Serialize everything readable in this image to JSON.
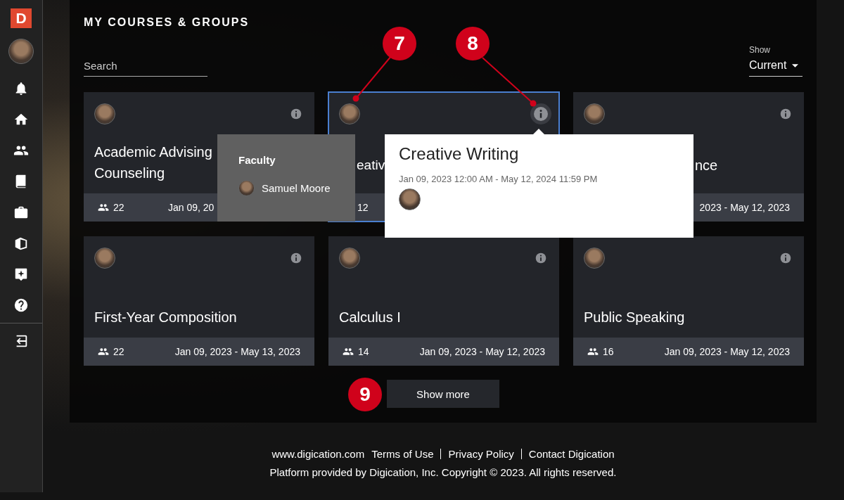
{
  "sidebar": {
    "logo": "D",
    "items": [
      {
        "kind": "bell"
      },
      {
        "kind": "home"
      },
      {
        "kind": "people"
      },
      {
        "kind": "book"
      },
      {
        "kind": "briefcase"
      },
      {
        "kind": "books"
      },
      {
        "kind": "sparkle"
      },
      {
        "kind": "help"
      },
      {
        "kind": "logout"
      }
    ]
  },
  "page": {
    "title": "MY COURSES & GROUPS",
    "search": {
      "placeholder": "Search"
    },
    "show": {
      "label": "Show",
      "value": "Current"
    }
  },
  "cards": [
    {
      "kind": "under-right",
      "title_lines": [
        "Academic Advising",
        "Counseling"
      ],
      "members": "22",
      "dates": "Jan 09, 20",
      "selected": false
    },
    {
      "kind": "under-both",
      "title_lines": [
        "eativ"
      ],
      "members": "12",
      "selected": true
    },
    {
      "kind": "under-left",
      "title_lines": [
        "nce"
      ],
      "dates": "2023 - May 12, 2023",
      "selected": false
    },
    {
      "kind": "full",
      "title_lines": [
        "First-Year Composition"
      ],
      "members": "22",
      "dates": "Jan 09, 2023 - May 13, 2023",
      "selected": false
    },
    {
      "kind": "full",
      "title_lines": [
        "Calculus I"
      ],
      "members": "14",
      "dates": "Jan 09, 2023 - May 12, 2023",
      "selected": false
    },
    {
      "kind": "full",
      "title_lines": [
        "Public Speaking"
      ],
      "members": "16",
      "dates": "Jan 09, 2023 - May 12, 2023",
      "selected": false
    }
  ],
  "show_more": "Show more",
  "faculty_popup": {
    "heading": "Faculty",
    "name": "Samuel Moore"
  },
  "info_popup": {
    "title": "Creative Writing",
    "dates": "Jan 09, 2023 12:00 AM - May 12, 2024 11:59 PM"
  },
  "annotations": [
    {
      "label": "7"
    },
    {
      "label": "8"
    },
    {
      "label": "9"
    }
  ],
  "footer": {
    "links": [
      "www.digication.com",
      "Terms of Use",
      "Privacy Policy",
      "Contact Digication"
    ],
    "copyright": "Platform provided by Digication, Inc. Copyright © 2023. All rights reserved."
  }
}
